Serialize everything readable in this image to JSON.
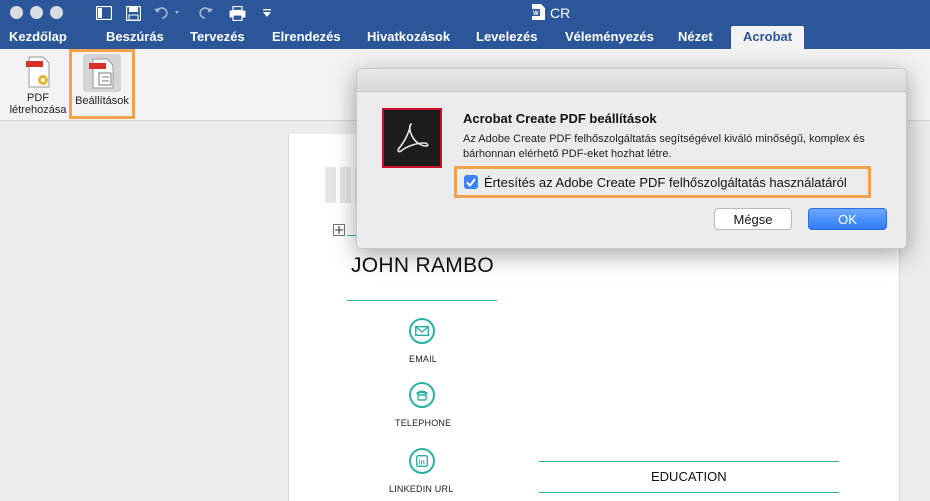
{
  "window": {
    "title": "CR"
  },
  "tabs": [
    {
      "label": "Kezdőlap"
    },
    {
      "label": "Beszúrás"
    },
    {
      "label": "Tervezés"
    },
    {
      "label": "Elrendezés"
    },
    {
      "label": "Hivatkozások"
    },
    {
      "label": "Levelezés"
    },
    {
      "label": "Véleményezés"
    },
    {
      "label": "Nézet"
    },
    {
      "label": "Acrobat"
    }
  ],
  "ribbon": {
    "create_pdf_line1": "PDF",
    "create_pdf_line2": "létrehozása",
    "settings_label": "Beállítások"
  },
  "document": {
    "name": "JOHN RAMBO",
    "contacts": {
      "email": "EMAIL",
      "telephone": "TELEPHONE",
      "linkedin": "LINKEDIN URL"
    },
    "section_education": "EDUCATION"
  },
  "dialog": {
    "title": "Acrobat Create PDF beállítások",
    "description": "Az Adobe Create PDF felhőszolgáltatás segítségével kiváló minőségű, komplex és bárhonnan elérhető PDF-eket hozhat létre.",
    "checkbox_label": "Értesítés az Adobe Create PDF felhőszolgáltatás használatáról",
    "checkbox_checked": true,
    "cancel_label": "Mégse",
    "ok_label": "OK"
  },
  "colors": {
    "word_blue": "#2b579a",
    "highlight_orange": "#f2a24a",
    "accent_teal": "#2ab0a6",
    "acrobat_red": "#c8102e"
  }
}
